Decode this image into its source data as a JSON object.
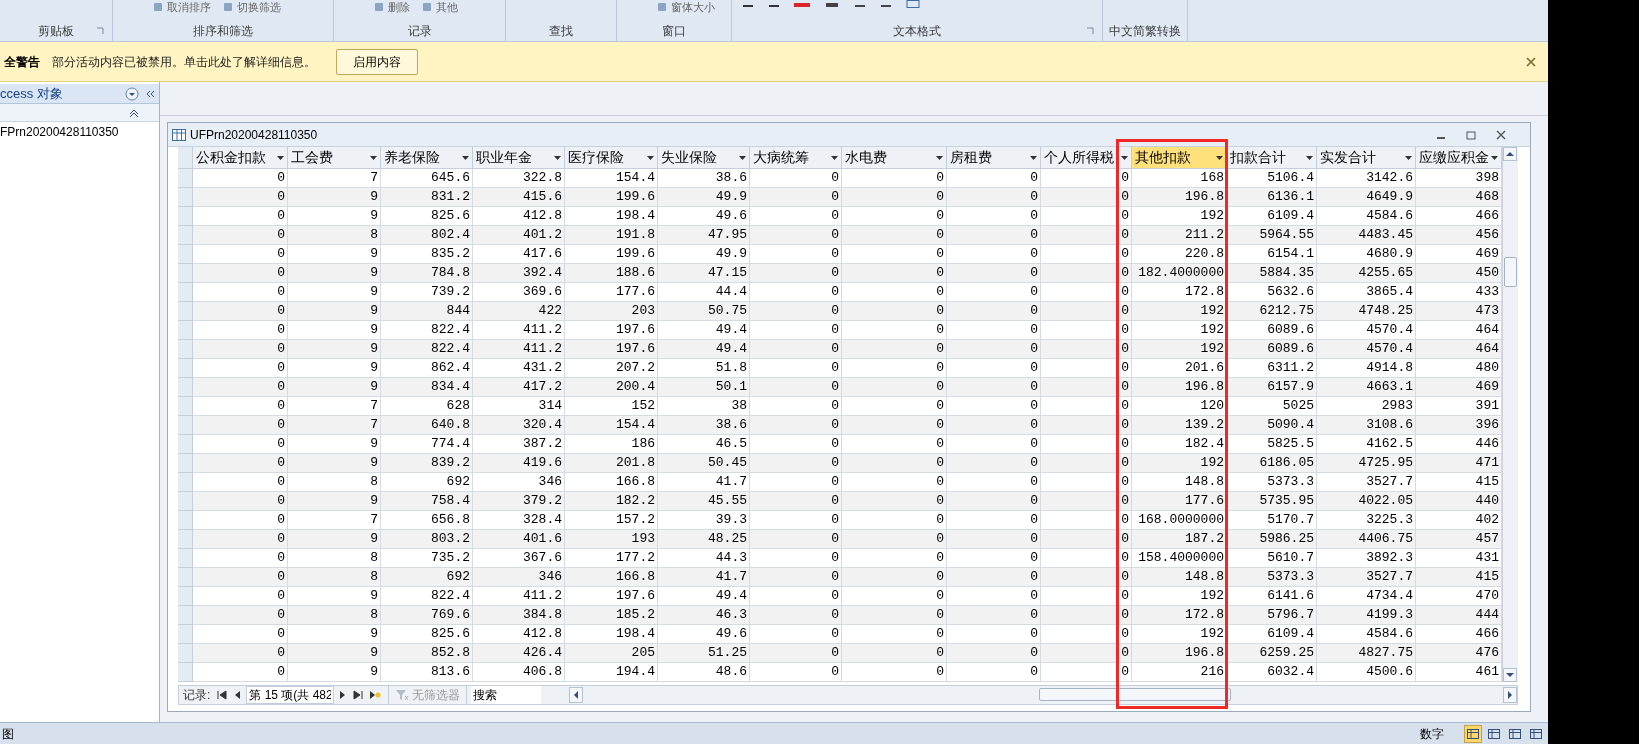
{
  "ribbon": {
    "groups": [
      {
        "label": "剪贴板",
        "launcher": true
      },
      {
        "label": "排序和筛选",
        "controls": [
          "取消排序",
          "切换筛选"
        ],
        "launcher": false
      },
      {
        "label": "记录",
        "controls": [
          "删除",
          "其他"
        ],
        "launcher": false
      },
      {
        "label": "查找",
        "launcher": false
      },
      {
        "label": "窗口",
        "controls": [
          "窗体大小"
        ],
        "launcher": false
      },
      {
        "label": "文本格式",
        "launcher": true
      },
      {
        "label": "中文简繁转换",
        "launcher": false
      }
    ]
  },
  "message_bar": {
    "title": "全警告",
    "text": "部分活动内容已被禁用。单击此处了解详细信息。",
    "button": "启用内容"
  },
  "navigation_pane": {
    "title": "ccess 对象",
    "items": [
      "FPrn20200428110350"
    ]
  },
  "document": {
    "title": "UFPrn20200428110350",
    "columns": [
      {
        "label": "公积金扣款",
        "selected": false
      },
      {
        "label": "工会费",
        "selected": false
      },
      {
        "label": "养老保险",
        "selected": false
      },
      {
        "label": "职业年金",
        "selected": false
      },
      {
        "label": "医疗保险",
        "selected": false
      },
      {
        "label": "失业保险",
        "selected": false
      },
      {
        "label": "大病统筹",
        "selected": false
      },
      {
        "label": "水电费",
        "selected": false
      },
      {
        "label": "房租费",
        "selected": false
      },
      {
        "label": "个人所得税",
        "selected": false
      },
      {
        "label": "其他扣款",
        "selected": true
      },
      {
        "label": "扣款合计",
        "selected": false
      },
      {
        "label": "实发合计",
        "selected": false
      },
      {
        "label": "应缴应积金",
        "selected": false
      }
    ],
    "rows": [
      [
        "0",
        "7",
        "645.6",
        "322.8",
        "154.4",
        "38.6",
        "0",
        "0",
        "0",
        "0",
        "168",
        "5106.4",
        "3142.6",
        "398"
      ],
      [
        "0",
        "9",
        "831.2",
        "415.6",
        "199.6",
        "49.9",
        "0",
        "0",
        "0",
        "0",
        "196.8",
        "6136.1",
        "4649.9",
        "468"
      ],
      [
        "0",
        "9",
        "825.6",
        "412.8",
        "198.4",
        "49.6",
        "0",
        "0",
        "0",
        "0",
        "192",
        "6109.4",
        "4584.6",
        "466"
      ],
      [
        "0",
        "8",
        "802.4",
        "401.2",
        "191.8",
        "47.95",
        "0",
        "0",
        "0",
        "0",
        "211.2",
        "5964.55",
        "4483.45",
        "456"
      ],
      [
        "0",
        "9",
        "835.2",
        "417.6",
        "199.6",
        "49.9",
        "0",
        "0",
        "0",
        "0",
        "220.8",
        "6154.1",
        "4680.9",
        "469"
      ],
      [
        "0",
        "9",
        "784.8",
        "392.4",
        "188.6",
        "47.15",
        "0",
        "0",
        "0",
        "0",
        "182.4000000",
        "5884.35",
        "4255.65",
        "450"
      ],
      [
        "0",
        "9",
        "739.2",
        "369.6",
        "177.6",
        "44.4",
        "0",
        "0",
        "0",
        "0",
        "172.8",
        "5632.6",
        "3865.4",
        "433"
      ],
      [
        "0",
        "9",
        "844",
        "422",
        "203",
        "50.75",
        "0",
        "0",
        "0",
        "0",
        "192",
        "6212.75",
        "4748.25",
        "473"
      ],
      [
        "0",
        "9",
        "822.4",
        "411.2",
        "197.6",
        "49.4",
        "0",
        "0",
        "0",
        "0",
        "192",
        "6089.6",
        "4570.4",
        "464"
      ],
      [
        "0",
        "9",
        "822.4",
        "411.2",
        "197.6",
        "49.4",
        "0",
        "0",
        "0",
        "0",
        "192",
        "6089.6",
        "4570.4",
        "464"
      ],
      [
        "0",
        "9",
        "862.4",
        "431.2",
        "207.2",
        "51.8",
        "0",
        "0",
        "0",
        "0",
        "201.6",
        "6311.2",
        "4914.8",
        "480"
      ],
      [
        "0",
        "9",
        "834.4",
        "417.2",
        "200.4",
        "50.1",
        "0",
        "0",
        "0",
        "0",
        "196.8",
        "6157.9",
        "4663.1",
        "469"
      ],
      [
        "0",
        "7",
        "628",
        "314",
        "152",
        "38",
        "0",
        "0",
        "0",
        "0",
        "120",
        "5025",
        "2983",
        "391"
      ],
      [
        "0",
        "7",
        "640.8",
        "320.4",
        "154.4",
        "38.6",
        "0",
        "0",
        "0",
        "0",
        "139.2",
        "5090.4",
        "3108.6",
        "396"
      ],
      [
        "0",
        "9",
        "774.4",
        "387.2",
        "186",
        "46.5",
        "0",
        "0",
        "0",
        "0",
        "182.4",
        "5825.5",
        "4162.5",
        "446"
      ],
      [
        "0",
        "9",
        "839.2",
        "419.6",
        "201.8",
        "50.45",
        "0",
        "0",
        "0",
        "0",
        "192",
        "6186.05",
        "4725.95",
        "471"
      ],
      [
        "0",
        "8",
        "692",
        "346",
        "166.8",
        "41.7",
        "0",
        "0",
        "0",
        "0",
        "148.8",
        "5373.3",
        "3527.7",
        "415"
      ],
      [
        "0",
        "9",
        "758.4",
        "379.2",
        "182.2",
        "45.55",
        "0",
        "0",
        "0",
        "0",
        "177.6",
        "5735.95",
        "4022.05",
        "440"
      ],
      [
        "0",
        "7",
        "656.8",
        "328.4",
        "157.2",
        "39.3",
        "0",
        "0",
        "0",
        "0",
        "168.0000000",
        "5170.7",
        "3225.3",
        "402"
      ],
      [
        "0",
        "9",
        "803.2",
        "401.6",
        "193",
        "48.25",
        "0",
        "0",
        "0",
        "0",
        "187.2",
        "5986.25",
        "4406.75",
        "457"
      ],
      [
        "0",
        "8",
        "735.2",
        "367.6",
        "177.2",
        "44.3",
        "0",
        "0",
        "0",
        "0",
        "158.4000000",
        "5610.7",
        "3892.3",
        "431"
      ],
      [
        "0",
        "8",
        "692",
        "346",
        "166.8",
        "41.7",
        "0",
        "0",
        "0",
        "0",
        "148.8",
        "5373.3",
        "3527.7",
        "415"
      ],
      [
        "0",
        "9",
        "822.4",
        "411.2",
        "197.6",
        "49.4",
        "0",
        "0",
        "0",
        "0",
        "192",
        "6141.6",
        "4734.4",
        "470"
      ],
      [
        "0",
        "8",
        "769.6",
        "384.8",
        "185.2",
        "46.3",
        "0",
        "0",
        "0",
        "0",
        "172.8",
        "5796.7",
        "4199.3",
        "444"
      ],
      [
        "0",
        "9",
        "825.6",
        "412.8",
        "198.4",
        "49.6",
        "0",
        "0",
        "0",
        "0",
        "192",
        "6109.4",
        "4584.6",
        "466"
      ],
      [
        "0",
        "9",
        "852.8",
        "426.4",
        "205",
        "51.25",
        "0",
        "0",
        "0",
        "0",
        "196.8",
        "6259.25",
        "4827.75",
        "476"
      ],
      [
        "0",
        "9",
        "813.6",
        "406.8",
        "194.4",
        "48.6",
        "0",
        "0",
        "0",
        "0",
        "216",
        "6032.4",
        "4500.6",
        "461"
      ]
    ]
  },
  "record_navigator": {
    "label": "记录:",
    "position": "第 15 项(共 482",
    "filter": "无筛选器",
    "search_placeholder": "搜索"
  },
  "status_bar": {
    "left": "图",
    "mode": "数字",
    "views": [
      {
        "selected": true
      },
      {
        "selected": false
      },
      {
        "selected": false
      },
      {
        "selected": false
      }
    ]
  }
}
